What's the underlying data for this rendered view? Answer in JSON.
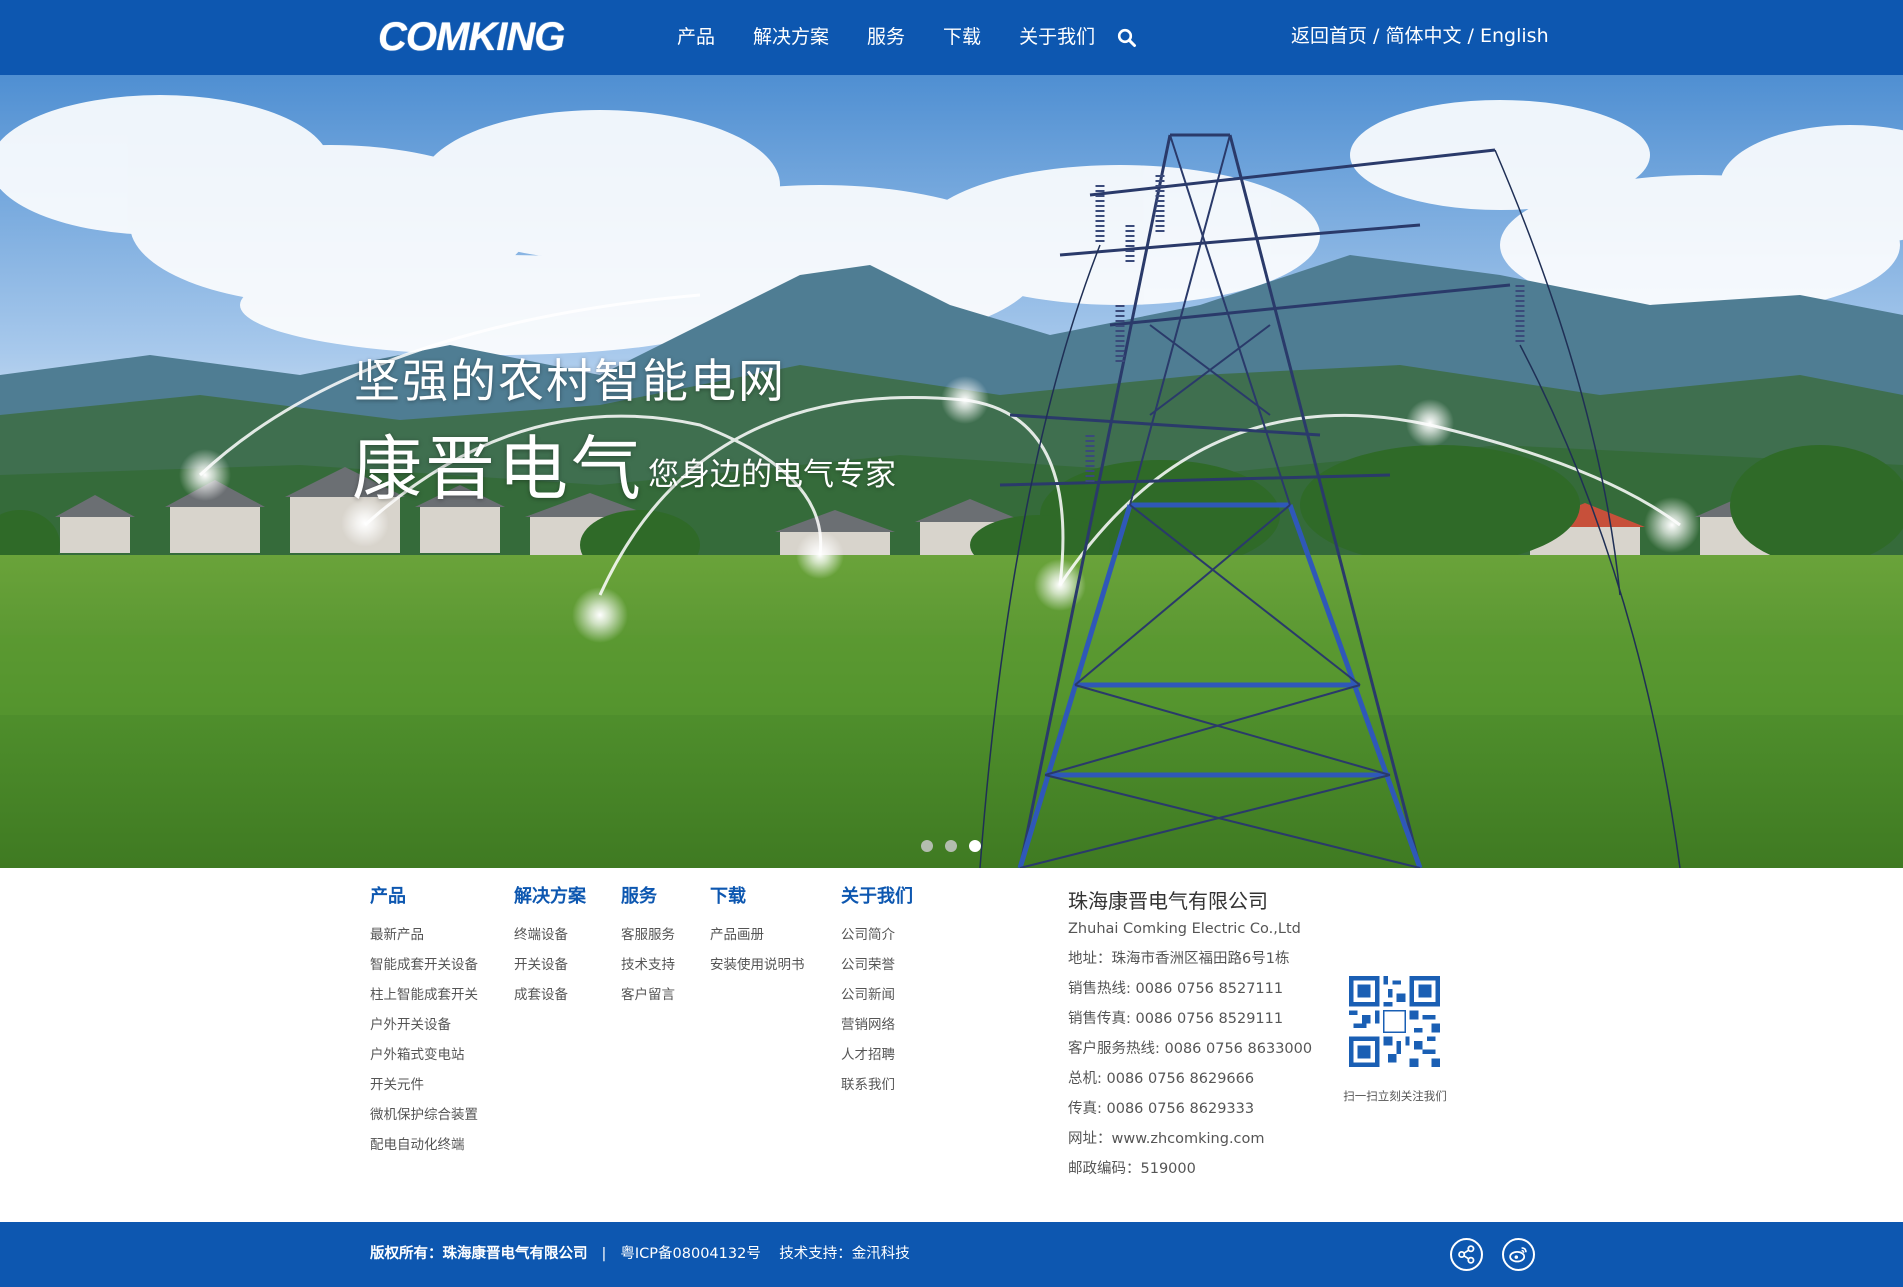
{
  "header": {
    "logo_text": "COMKING",
    "nav": [
      "产品",
      "解决方案",
      "服务",
      "下载",
      "关于我们"
    ],
    "search_icon": "search-icon",
    "top_links": {
      "home": "返回首页",
      "sep1": " / ",
      "chinese": "简体中文",
      "sep2": " / ",
      "english": "English"
    }
  },
  "banner": {
    "slogan_line1": "坚强的农村智能电网",
    "slogan_brand": "康晋电气",
    "slogan_tagline": "您身边的电气专家",
    "slide_count": 3,
    "active_slide": 3
  },
  "footer": {
    "columns": [
      {
        "title": "产品",
        "items": [
          "最新产品",
          "智能成套开关设备",
          "柱上智能成套开关",
          "户外开关设备",
          "户外箱式变电站",
          "开关元件",
          "微机保护综合装置",
          "配电自动化终端"
        ]
      },
      {
        "title": "解决方案",
        "items": [
          "终端设备",
          "开关设备",
          "成套设备"
        ]
      },
      {
        "title": "服务",
        "items": [
          "客服服务",
          "技术支持",
          "客户留言"
        ]
      },
      {
        "title": "下载",
        "items": [
          "产品画册",
          "安装使用说明书"
        ]
      },
      {
        "title": "关于我们",
        "items": [
          "公司简介",
          "公司荣誉",
          "公司新闻",
          "营销网络",
          "人才招聘",
          "联系我们"
        ]
      }
    ],
    "company": {
      "name": "珠海康晋电气有限公司",
      "name_en": "Zhuhai Comking Electric Co.,Ltd",
      "lines": [
        "地址：珠海市香洲区福田路6号1栋",
        "销售热线: 0086 0756 8527111",
        "销售传真: 0086 0756 8529111",
        "客户服务热线: 0086 0756 8633000",
        "总机: 0086 0756 8629666",
        "传真: 0086 0756 8629333",
        "网址：www.zhcomking.com",
        "邮政编码：519000"
      ]
    },
    "qr_caption": "扫一扫立刻关注我们"
  },
  "bottom": {
    "copyright_label": "版权所有：",
    "copyright_company": "珠海康晋电气有限公司",
    "separator": "|",
    "icp": "粤ICP备08004132号",
    "support_label": "技术支持：",
    "support_company": "金汛科技",
    "icons": [
      "share-icon",
      "weibo-icon"
    ]
  },
  "colors": {
    "brand_blue": "#0d57b0",
    "white": "#ffffff",
    "text_gray": "#555555"
  }
}
